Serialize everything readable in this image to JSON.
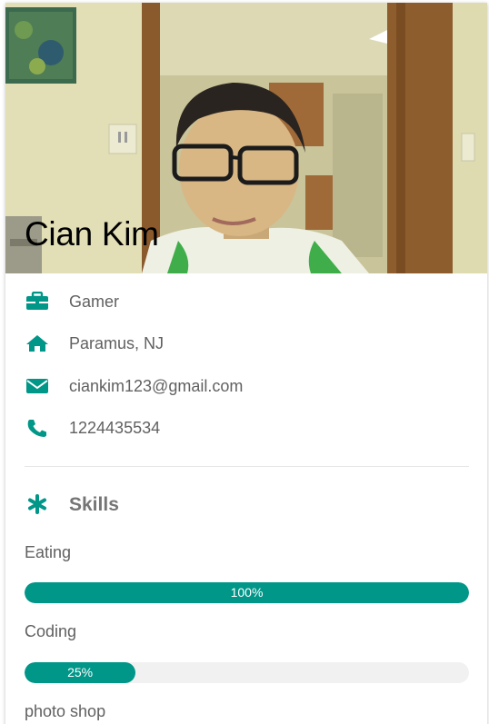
{
  "profile": {
    "name": "Cian Kim",
    "occupation": "Gamer",
    "location": "Paramus, NJ",
    "email": "ciankim123@gmail.com",
    "phone": "1224435534"
  },
  "icons": {
    "occupation": "briefcase-icon",
    "location": "home-icon",
    "email": "envelope-icon",
    "phone": "phone-icon",
    "skills": "asterisk-icon"
  },
  "skills": {
    "title": "Skills",
    "items": [
      {
        "label": "Eating",
        "percent": 100,
        "percent_label": "100%"
      },
      {
        "label": "Coding",
        "percent": 25,
        "percent_label": "25%"
      },
      {
        "label": "photo shop"
      }
    ]
  },
  "colors": {
    "accent": "#009688",
    "track": "#f1f1f1",
    "text": "#616161",
    "heading": "#757575"
  }
}
